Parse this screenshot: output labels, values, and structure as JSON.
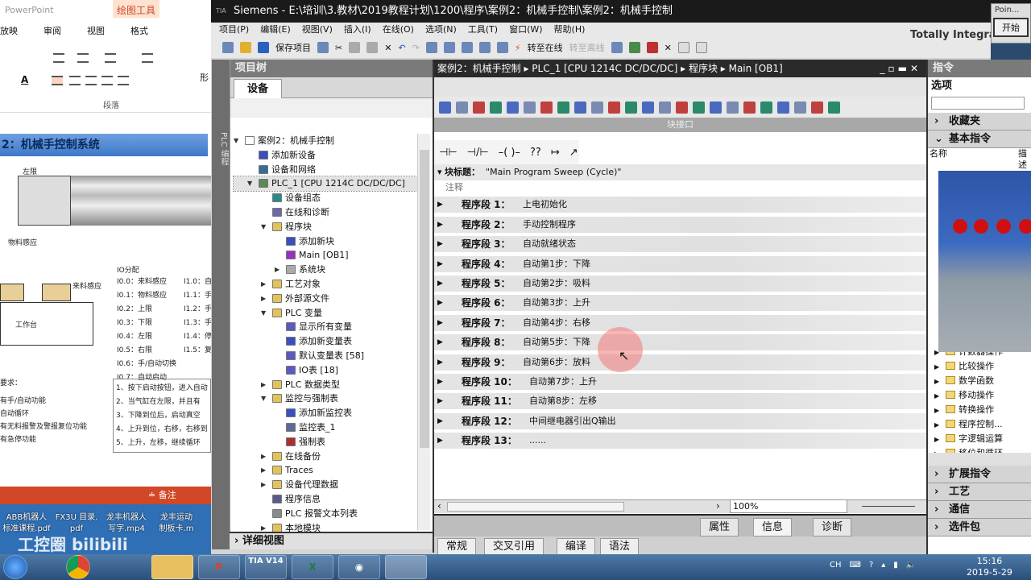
{
  "ppt": {
    "app": "PowerPoint",
    "tool_tab": "绘图工具",
    "tabs": [
      "放映",
      "审阅",
      "视图",
      "格式"
    ],
    "group": "段落",
    "shape_label": "形",
    "slide": {
      "title": "2：机械手控制系统",
      "labels": {
        "left_limit": "左限",
        "material_sensor": "物料感应",
        "incoming_sensor": "来料感应",
        "worktable": "工作台"
      },
      "io_title": "IO分配",
      "io_left": [
        "I0.0：来料感应",
        "I0.1：物料感应",
        "I0.2：上限",
        "I0.3：下限",
        "I0.4：左限",
        "I0.5：右限",
        "I0.6：手/自动切换",
        "I0.7：自动启动"
      ],
      "io_right": [
        "I1.0：自",
        "I1.1：手",
        "I1.2：手",
        "I1.3：手",
        "I1.4：停",
        "I1.5：复"
      ],
      "req_title": "要求：",
      "reqs": [
        "有手/自动功能",
        "自动循环",
        "有无料报警及警报复位功能",
        "有急停功能"
      ],
      "steps": [
        "1、按下启动按钮，进入自动",
        "2、当气缸在左限，并且有",
        "3、下降到位后，启动真空",
        "4、上升到位，右移，右移到",
        "5、上升，左移，继续循环"
      ]
    },
    "status_notes": "≐ 备注"
  },
  "desktop": {
    "icons": [
      {
        "l1": "ABB机器人",
        "l2": "标准课程.pdf"
      },
      {
        "l1": "FX3U 目录.",
        "l2": "pdf"
      },
      {
        "l1": "龙丰机器人",
        "l2": "写字.mp4"
      },
      {
        "l1": "龙丰运动",
        "l2": "制板卡.m"
      }
    ],
    "watermark": "工控圈 bilibili"
  },
  "tia": {
    "title": "Siemens  -  E:\\培训\\3.教材\\2019教程计划\\1200\\程序\\案例2：机械手控制\\案例2：机械手控制",
    "brand": "Totally Integrated",
    "menu": [
      "项目(P)",
      "编辑(E)",
      "视图(V)",
      "插入(I)",
      "在线(O)",
      "选项(N)",
      "工具(T)",
      "窗口(W)",
      "帮助(H)"
    ],
    "toolbar": {
      "save": "保存项目",
      "go_online": "转至在线",
      "go_offline": "转至离线"
    },
    "popup": {
      "title": "Poin...",
      "button": "开始"
    },
    "project_tree": {
      "header": "项目树",
      "tab": "设备",
      "side_strip": "PLC 编程",
      "detail_view": "详细视图",
      "items": [
        {
          "label": "案例2：机械手控制",
          "level": 0,
          "arrow": "▼",
          "color": "#ffffff"
        },
        {
          "label": "添加新设备",
          "level": 1,
          "arrow": "",
          "color": "#3a4fc0"
        },
        {
          "label": "设备和网络",
          "level": 1,
          "arrow": "",
          "color": "#3a6a9a"
        },
        {
          "label": "PLC_1 [CPU 1214C DC/DC/DC]",
          "level": 1,
          "arrow": "▼",
          "color": "#5a8a5a",
          "selected": true
        },
        {
          "label": "设备组态",
          "level": 2,
          "arrow": "",
          "color": "#2a8a8a"
        },
        {
          "label": "在线和诊断",
          "level": 2,
          "arrow": "",
          "color": "#6a6aaa"
        },
        {
          "label": "程序块",
          "level": 2,
          "arrow": "▼",
          "color": "#e3c25a"
        },
        {
          "label": "添加新块",
          "level": 3,
          "arrow": "",
          "color": "#3a4fc0"
        },
        {
          "label": "Main [OB1]",
          "level": 3,
          "arrow": "",
          "color": "#9a30c0"
        },
        {
          "label": "系统块",
          "level": 3,
          "arrow": "▶",
          "color": "#aaaaaa"
        },
        {
          "label": "工艺对象",
          "level": 2,
          "arrow": "▶",
          "color": "#e3c25a"
        },
        {
          "label": "外部源文件",
          "level": 2,
          "arrow": "▶",
          "color": "#e3c25a"
        },
        {
          "label": "PLC 变量",
          "level": 2,
          "arrow": "▼",
          "color": "#e3c25a"
        },
        {
          "label": "显示所有变量",
          "level": 3,
          "arrow": "",
          "color": "#5a5ac0"
        },
        {
          "label": "添加新变量表",
          "level": 3,
          "arrow": "",
          "color": "#3a4fc0"
        },
        {
          "label": "默认变量表 [58]",
          "level": 3,
          "arrow": "",
          "color": "#5a5ac0"
        },
        {
          "label": "IO表 [18]",
          "level": 3,
          "arrow": "",
          "color": "#5a5ac0"
        },
        {
          "label": "PLC 数据类型",
          "level": 2,
          "arrow": "▶",
          "color": "#e3c25a"
        },
        {
          "label": "监控与强制表",
          "level": 2,
          "arrow": "▼",
          "color": "#e3c25a"
        },
        {
          "label": "添加新监控表",
          "level": 3,
          "arrow": "",
          "color": "#3a4fc0"
        },
        {
          "label": "监控表_1",
          "level": 3,
          "arrow": "",
          "color": "#5a6a9a"
        },
        {
          "label": "强制表",
          "level": 3,
          "arrow": "",
          "color": "#aa3030"
        },
        {
          "label": "在线备份",
          "level": 2,
          "arrow": "▶",
          "color": "#e3c25a"
        },
        {
          "label": "Traces",
          "level": 2,
          "arrow": "▶",
          "color": "#e3c25a"
        },
        {
          "label": "设备代理数据",
          "level": 2,
          "arrow": "▶",
          "color": "#e3c25a"
        },
        {
          "label": "程序信息",
          "level": 2,
          "arrow": "",
          "color": "#5a5a8a"
        },
        {
          "label": "PLC 报警文本列表",
          "level": 2,
          "arrow": "",
          "color": "#8a8a8a"
        },
        {
          "label": "本地模块",
          "level": 2,
          "arrow": "▶",
          "color": "#e3c25a"
        }
      ]
    },
    "editor": {
      "breadcrumb": "案例2：机械手控制 ▸ PLC_1 [CPU 1214C DC/DC/DC] ▸ 程序块 ▸ Main [OB1]",
      "interface_bar": "块接口",
      "lad": [
        "⊣⊢",
        "⊣/⊢",
        "–( )–",
        "??",
        "↦",
        "↗"
      ],
      "block_title_label": "块标题：",
      "block_title": "\"Main Program Sweep (Cycle)\"",
      "comment": "注释",
      "networks": [
        {
          "label": "程序段 1：",
          "comment": "上电初始化"
        },
        {
          "label": "程序段 2：",
          "comment": "手动控制程序"
        },
        {
          "label": "程序段 3：",
          "comment": "自动就绪状态"
        },
        {
          "label": "程序段 4：",
          "comment": "自动第1步：下降"
        },
        {
          "label": "程序段 5：",
          "comment": "自动第2步：吸料"
        },
        {
          "label": "程序段 6：",
          "comment": "自动第3步：上升"
        },
        {
          "label": "程序段 7：",
          "comment": "自动第4步：右移"
        },
        {
          "label": "程序段 8：",
          "comment": "自动第5步：下降"
        },
        {
          "label": "程序段 9：",
          "comment": "自动第6步：放料"
        },
        {
          "label": "程序段 10：",
          "comment": "自动第7步：上升"
        },
        {
          "label": "程序段 11：",
          "comment": "自动第8步：左移"
        },
        {
          "label": "程序段 12：",
          "comment": "中间继电器引出Q输出"
        },
        {
          "label": "程序段 13：",
          "comment": "......"
        }
      ],
      "zoom": "100%"
    },
    "inspector": {
      "tabs": [
        "属性",
        "信息",
        "诊断"
      ],
      "subtabs": [
        "常规",
        "交叉引用",
        "编译",
        "语法"
      ]
    },
    "instructions": {
      "header": "指令",
      "options": "选项",
      "favorites": "收藏夹",
      "basic": "基本指令",
      "col_name": "名称",
      "col_desc": "描述",
      "items": [
        "计数器操作",
        "比较操作",
        "数学函数",
        "移动操作",
        "转换操作",
        "程序控制...",
        "字逻辑运算",
        "移位和循环"
      ],
      "sections": [
        "扩展指令",
        "工艺",
        "通信",
        "选件包"
      ]
    }
  },
  "taskbar": {
    "apps": [
      "TIA V14"
    ],
    "tray_lang": "CH",
    "time": "15:16",
    "date": "2019-5-29"
  }
}
